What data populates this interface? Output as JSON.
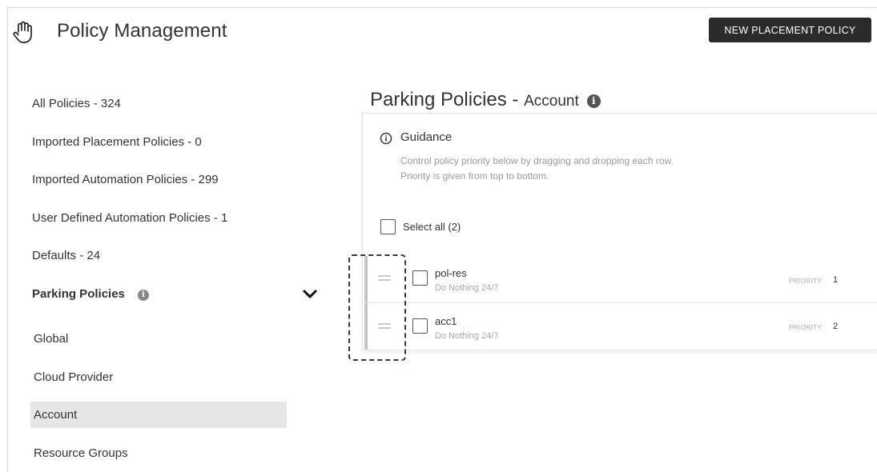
{
  "header": {
    "title": "Policy Management",
    "icon": "hand-icon",
    "new_policy_button": "NEW PLACEMENT POLICY"
  },
  "sidebar": {
    "items": [
      {
        "label": "All Policies - 324"
      },
      {
        "label": "Imported Placement Policies - 0"
      },
      {
        "label": "Imported Automation Policies - 299"
      },
      {
        "label": "User Defined Automation Policies - 1"
      },
      {
        "label": "Defaults - 24"
      }
    ],
    "parking": {
      "label": "Parking Policies",
      "info_icon": "info-icon",
      "expand_icon": "chevron-down-icon",
      "children": [
        {
          "label": "Global"
        },
        {
          "label": "Cloud Provider"
        },
        {
          "label": "Account",
          "selected": true
        },
        {
          "label": "Resource Groups"
        }
      ]
    }
  },
  "main": {
    "title": "Parking Policies - ",
    "scope": "Account",
    "guidance": {
      "title": "Guidance",
      "line1": "Control policy priority below by dragging and dropping each row.",
      "line2": "Priority is given from top to bottom."
    },
    "select_all_label": "Select all (2)",
    "priority_label": "PRIORITY:",
    "rows": [
      {
        "name": "pol-res",
        "description": "Do Nothing 24/7",
        "priority": "1"
      },
      {
        "name": "acc1",
        "description": "Do Nothing 24/7",
        "priority": "2"
      }
    ]
  },
  "colors": {
    "button_bg": "#2b2b2b",
    "selected_bg": "#e6e6e6",
    "highlight_border": "#2f3a46"
  }
}
